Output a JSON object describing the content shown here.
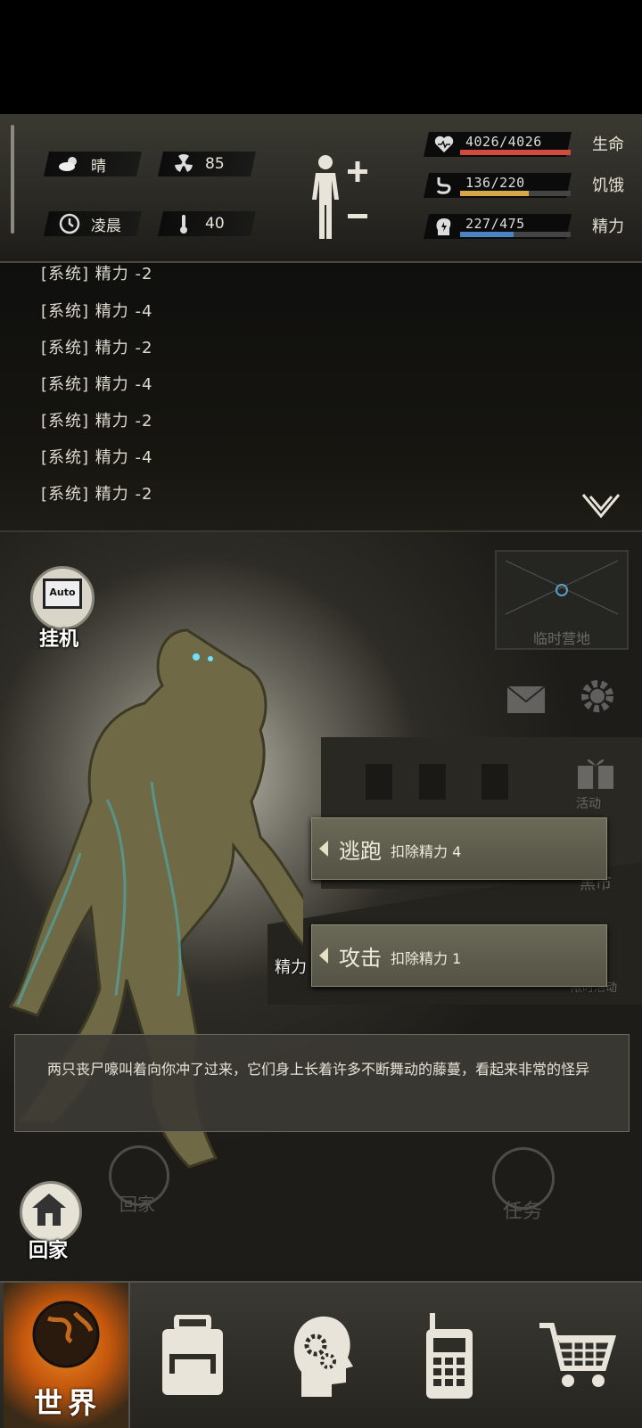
{
  "status": {
    "weather": "晴",
    "time_of_day": "凌晨",
    "radiation": "85",
    "temperature": "40",
    "stats": [
      {
        "text": "4026/4026",
        "label": "生命",
        "fill": 1.0,
        "color": "#d24a3e"
      },
      {
        "text": "136/220",
        "label": "饥饿",
        "fill": 0.62,
        "color": "#d7a84a"
      },
      {
        "text": "227/475",
        "label": "精力",
        "fill": 0.48,
        "color": "#4a84c4"
      }
    ]
  },
  "log": {
    "lines": [
      "[系统] 精力 -2",
      "[系统] 精力 -4",
      "[系统] 精力 -2",
      "[系统] 精力 -4",
      "[系统] 精力 -2",
      "[系统] 精力 -4",
      "[系统] 精力 -2"
    ]
  },
  "scene": {
    "auto_label": "Auto",
    "auto_caption": "挂机",
    "camp_label": "临时营地",
    "gift_label": "活动",
    "black_market_label": "黑市",
    "event_label": "限时活动",
    "floating_text": "精力 -2",
    "home_label": "回家",
    "home_label_faded": "回家",
    "task_label": "任务"
  },
  "actions": [
    {
      "name": "逃跑",
      "cost": "扣除精力 4"
    },
    {
      "name": "攻击",
      "cost": "扣除精力 1"
    }
  ],
  "message": "两只丧尸嚎叫着向你冲了过来，它们身上长着许多不断舞动的藤蔓，看起来非常的怪异",
  "tabs": {
    "world_label": "世界",
    "items": [
      "world-icon",
      "backpack-icon",
      "skills-head-icon",
      "radio-icon",
      "cart-icon"
    ]
  }
}
